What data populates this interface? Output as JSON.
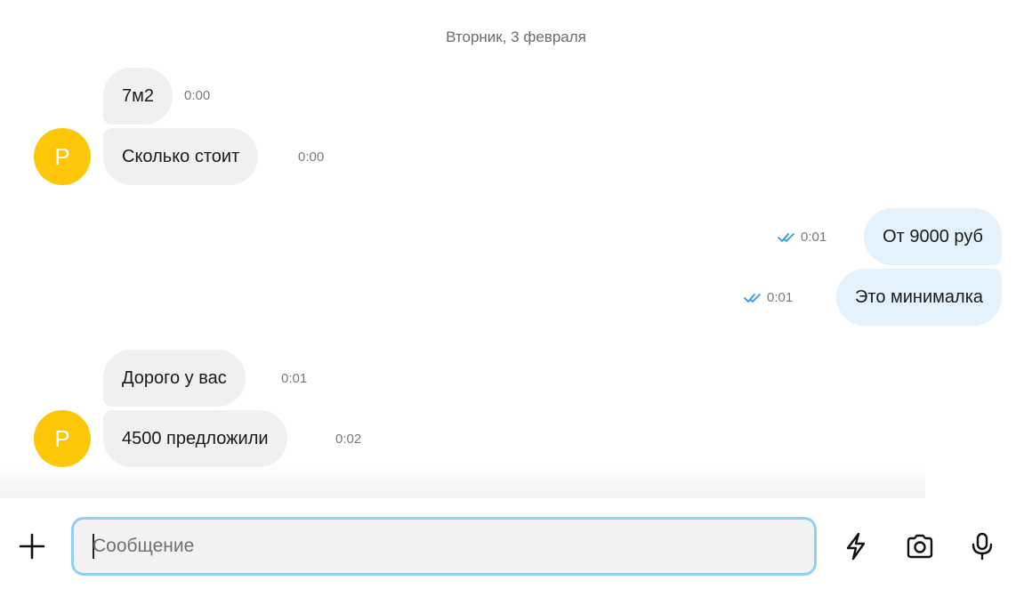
{
  "chat": {
    "date_separator": "Вторник, 3 февраля",
    "avatar_letter": "Р",
    "messages": [
      {
        "direction": "in",
        "text": "7м2",
        "time": "0:00"
      },
      {
        "direction": "in",
        "text": "Сколько стоит",
        "time": "0:00"
      },
      {
        "direction": "out",
        "text": "От 9000 руб",
        "time": "0:01",
        "read": true
      },
      {
        "direction": "out",
        "text": "Это минималка",
        "time": "0:01",
        "read": true
      },
      {
        "direction": "in",
        "text": "Дорого у вас",
        "time": "0:01"
      },
      {
        "direction": "in",
        "text": "4500 предложили",
        "time": "0:02"
      }
    ]
  },
  "composer": {
    "placeholder": "Сообщение",
    "value": "",
    "icons": [
      "plus-icon",
      "lightning-icon",
      "camera-icon",
      "microphone-icon"
    ]
  },
  "colors": {
    "avatar": "#fcc707",
    "incoming_bubble": "#f1f0ef",
    "outgoing_bubble": "#e3f2fd",
    "read_checks": "#2e9be6",
    "input_border": "#8fd0f5"
  }
}
